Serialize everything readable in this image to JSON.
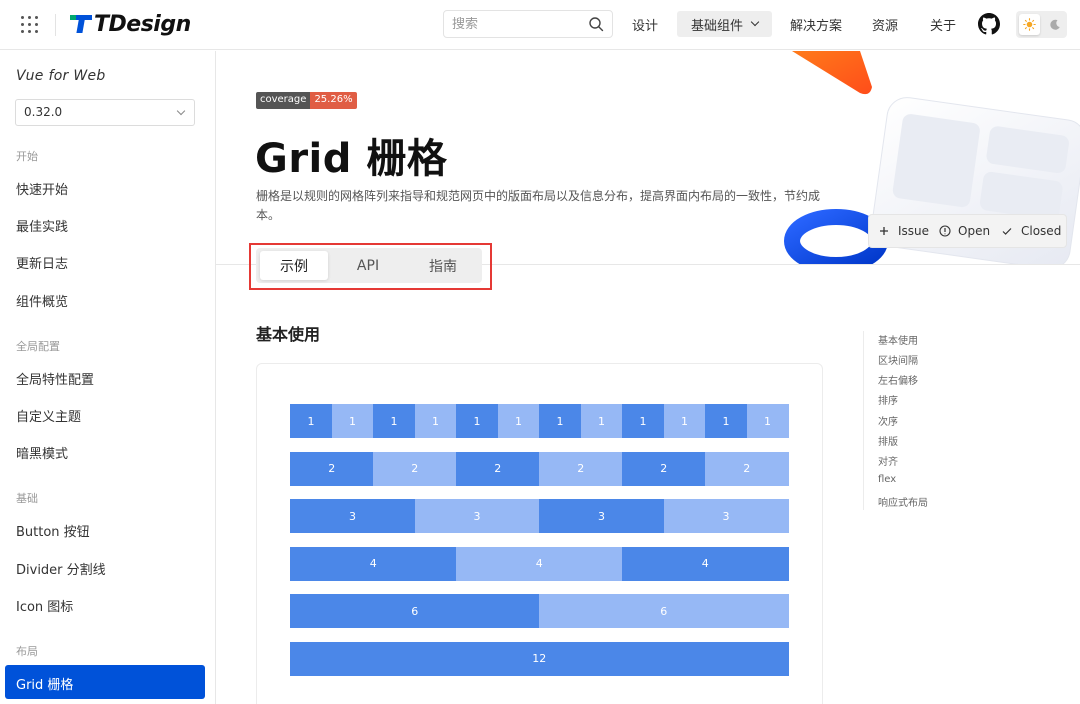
{
  "header": {
    "logo_text": "TDesign",
    "search_placeholder": "搜索",
    "nav": [
      {
        "label": "设计"
      },
      {
        "label": "基础组件",
        "active": true
      },
      {
        "label": "解决方案"
      },
      {
        "label": "资源"
      },
      {
        "label": "关于"
      }
    ]
  },
  "sidebar": {
    "title": "Vue for Web",
    "version": "0.32.0",
    "groups": [
      {
        "label": "开始",
        "items": [
          "快速开始",
          "最佳实践",
          "更新日志",
          "组件概览"
        ]
      },
      {
        "label": "全局配置",
        "items": [
          "全局特性配置",
          "自定义主题",
          "暗黑模式"
        ]
      },
      {
        "label": "基础",
        "items": [
          "Button 按钮",
          "Divider 分割线",
          "Icon 图标"
        ]
      },
      {
        "label": "布局",
        "items": [
          "Grid 栅格"
        ]
      }
    ],
    "active_item": "Grid 栅格"
  },
  "main": {
    "badge": {
      "label": "coverage",
      "value": "25.26%"
    },
    "title": "Grid 栅格",
    "description": "栅格是以规则的网格阵列来指导和规范网页中的版面布局以及信息分布，提高界面内布局的一致性，节约成本。",
    "tabs": [
      {
        "label": "示例",
        "active": true
      },
      {
        "label": "API"
      },
      {
        "label": "指南"
      }
    ],
    "section_title": "基本使用",
    "grid_rows": [
      {
        "span": 1,
        "count": 12
      },
      {
        "span": 2,
        "count": 6
      },
      {
        "span": 3,
        "count": 4
      },
      {
        "span": 4,
        "count": 3
      },
      {
        "span": 6,
        "count": 2
      },
      {
        "span": 12,
        "count": 1
      }
    ]
  },
  "issue_bar": {
    "issue": "Issue",
    "open": "Open",
    "closed": "Closed"
  },
  "anchor": [
    "基本使用",
    "区块间隔",
    "左右偏移",
    "排序",
    "次序",
    "排版",
    "对齐",
    "flex",
    "响应式布局"
  ],
  "colors": {
    "brand": "#0052d9",
    "cell_dark": "#4b87e8",
    "cell_light": "#96b8f5",
    "tab_highlight": "#e53935"
  }
}
